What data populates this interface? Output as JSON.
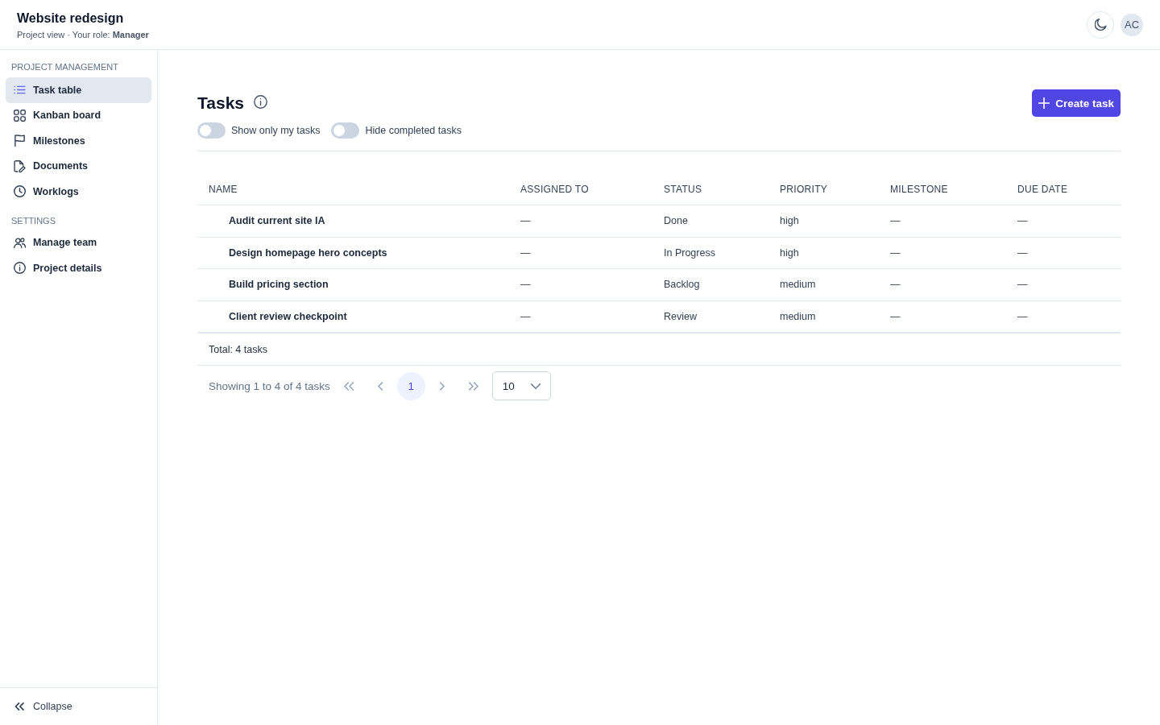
{
  "header": {
    "title": "Website redesign",
    "subtitle": "Project view · Your role: **Manager**",
    "avatar": "AC"
  },
  "sidebar": {
    "sections": [
      {
        "heading": "PROJECT MANAGEMENT",
        "items": [
          {
            "label": "Task table",
            "selected": true
          },
          {
            "label": "Kanban board",
            "selected": false
          },
          {
            "label": "Milestones",
            "selected": false
          },
          {
            "label": "Documents",
            "selected": false
          },
          {
            "label": "Worklogs",
            "selected": false
          }
        ]
      },
      {
        "heading": "SETTINGS",
        "items": [
          {
            "label": "Manage team",
            "selected": false
          },
          {
            "label": "Project details",
            "selected": false
          }
        ]
      }
    ],
    "collapse": "Collapse"
  },
  "page": {
    "title": "Tasks",
    "create_button": "Create task",
    "toggles": [
      {
        "label": "Show only my tasks",
        "on": false
      },
      {
        "label": "Hide completed tasks",
        "on": false
      }
    ]
  },
  "table": {
    "columns": [
      "NAME",
      "ASSIGNED TO",
      "STATUS",
      "PRIORITY",
      "MILESTONE",
      "DUE DATE"
    ],
    "rows": [
      [
        "Audit current site IA",
        "—",
        "Done",
        "high",
        "—",
        "—"
      ],
      [
        "Design homepage hero concepts",
        "—",
        "In Progress",
        "high",
        "—",
        "—"
      ],
      [
        "Build pricing section",
        "—",
        "Backlog",
        "medium",
        "—",
        "—"
      ],
      [
        "Client review checkpoint",
        "—",
        "Review",
        "medium",
        "—",
        "—"
      ]
    ],
    "total": "Total: 4 tasks"
  },
  "pagination": {
    "summary": "Showing 1 to 4 of 4 tasks",
    "pages": [
      {
        "label": "1",
        "selected": true
      }
    ],
    "page_size": "10"
  }
}
